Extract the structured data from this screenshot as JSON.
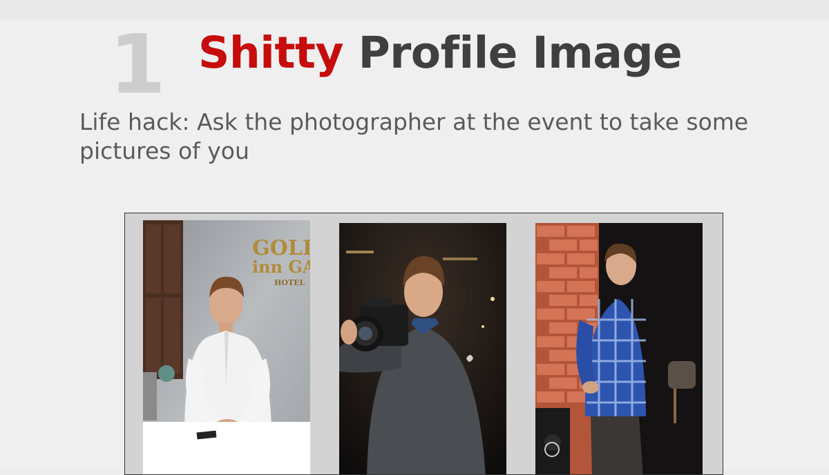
{
  "slide": {
    "number": "1",
    "title_accent": "Shitty",
    "title_rest": "Profile Image",
    "subtitle": "Life hack: Ask the photographer at the event to take some pictures of you"
  },
  "photos": [
    {
      "name": "photo-seated-hotel",
      "sign_lines": [
        "GOLD",
        "inn GA",
        "HOTEL"
      ]
    },
    {
      "name": "photo-with-camera"
    },
    {
      "name": "photo-brick-wall"
    }
  ],
  "colors": {
    "accent": "#c60c0c",
    "title": "#3f3f3f",
    "number": "#cdcdcd",
    "subtitle": "#5a5a5a"
  }
}
